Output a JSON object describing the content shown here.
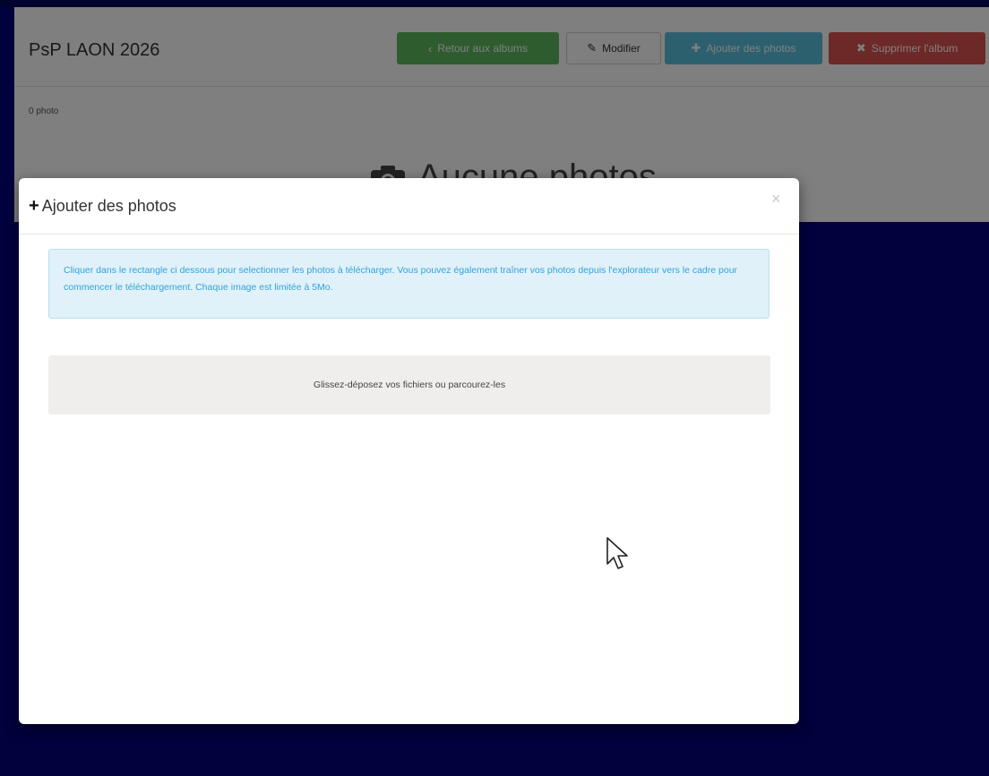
{
  "album": {
    "title": "PsP LAON 2026",
    "photo_count": "0 photo",
    "empty_message": "Aucune photos"
  },
  "toolbar": {
    "back_label": "Retour aux albums",
    "edit_label": "Modifier",
    "add_label": "Ajouter des photos",
    "delete_label": "Supprimer l'album"
  },
  "modal": {
    "title": "Ajouter des photos",
    "close_label": "×",
    "info_text": "Cliquer dans le rectangle ci dessous pour selectionner les photos à télécharger. Vous pouvez également traîner vos photos depuis l'explorateur vers le cadre pour commencer le téléchargement. Chaque image est limitée à 5Mo.",
    "dropzone_text": "Glissez-déposez vos fichiers ou parcourez-les"
  },
  "icons": {
    "back": "chevron-left-icon",
    "edit": "pencil-icon",
    "add": "plus-icon",
    "delete": "close-icon",
    "empty": "camera-icon",
    "modal_title": "plus-icon"
  },
  "colors": {
    "background": "#03037a",
    "success": "#5cb85c",
    "info": "#5bc0de",
    "danger": "#d9534f",
    "alert_text": "#31a3d6"
  }
}
